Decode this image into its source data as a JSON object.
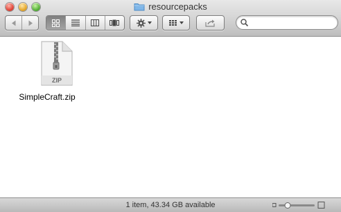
{
  "window": {
    "title": "resourcepacks"
  },
  "toolbar": {
    "nav": [
      "back-icon",
      "forward-icon"
    ],
    "views": [
      "icon-view-icon",
      "list-view-icon",
      "column-view-icon",
      "coverflow-view-icon"
    ],
    "active_view": "icon-view-icon",
    "action_icon": "gear-icon",
    "arrange_icon": "arrange-grid-icon",
    "share_icon": "share-icon",
    "search": {
      "value": "",
      "placeholder": ""
    }
  },
  "files": [
    {
      "name": "SimpleCraft.zip",
      "icon_label": "ZIP"
    }
  ],
  "status": {
    "text": "1 item, 43.34 GB available",
    "icon_size": 0.25
  },
  "colors": {
    "folder_blue": "#7fb6e8",
    "active_view": "#8e8e8e"
  }
}
